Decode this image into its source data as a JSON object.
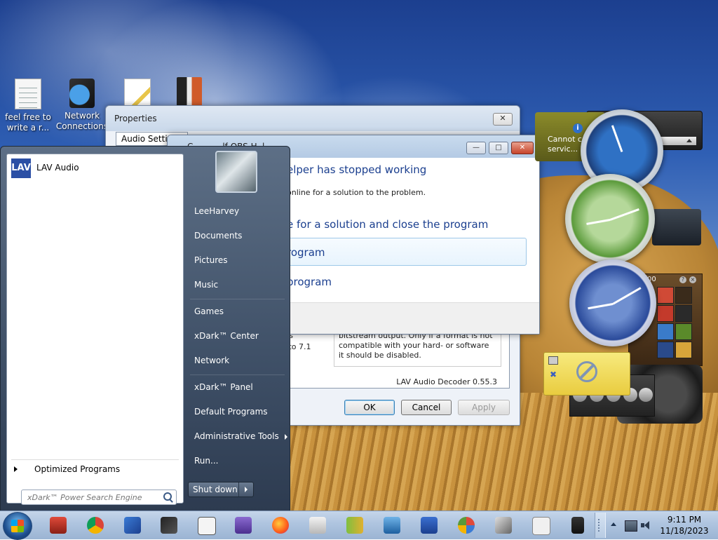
{
  "desktop": {
    "icons": [
      {
        "label": "feel free to write a r...",
        "icon": "text-document-icon"
      },
      {
        "label": "Network Connections",
        "icon": "network-connections-icon"
      },
      {
        "label": "",
        "icon": "paint-document-icon"
      },
      {
        "label": "",
        "icon": "library-book-icon"
      }
    ]
  },
  "properties_window": {
    "title": "Properties",
    "close_label": "✕",
    "tab": "Audio Settings",
    "fragment_left_1": "uts",
    "fragment_left_2": "1 to 7.1",
    "fragment_right": "bitstream output. Only if a format is not compatible with your hard- or software it should be disabled.",
    "version": "LAV Audio Decoder 0.55.3",
    "ok": "OK",
    "cancel": "Cancel",
    "apply": "Apply"
  },
  "error_dialog": {
    "title_fragment": "C...........lf OBS H..l...",
    "minimize": "—",
    "maximize": "□",
    "close": "✕",
    "heading": "elper has stopped working",
    "subtext": "online for a solution to the problem.",
    "option1": "e for a solution and close the program",
    "option2": "rogram",
    "option3": "program"
  },
  "start_menu": {
    "pinned": [
      {
        "label": "LAV Audio",
        "icon": "lav-audio-icon"
      }
    ],
    "all_programs": "Optimized Programs",
    "search_placeholder": "xDark™ Power Search Engine",
    "right_items": [
      "LeeHarvey",
      "Documents",
      "Pictures",
      "Music",
      "Games",
      "xDark™ Center",
      "Network",
      "xDark™ Panel",
      "Default Programs",
      "Administrative Tools",
      "Run..."
    ],
    "shutdown": "Shut down"
  },
  "gadgets": {
    "warning_text": "Cannot c... to servic...",
    "info_glyph": "i",
    "puzzle_number": "00",
    "puzzle_help": "?",
    "puzzle_close": "×"
  },
  "taskbar": {
    "apps": [
      "explorer-store-icon",
      "chrome-icon",
      "control-panel-icon",
      "paint-brush-icon",
      "solitaire-icon",
      "media-icon",
      "firefox-icon",
      "scanner-icon",
      "hxd-icon",
      "remote-desktop-icon",
      "system-monitor-icon",
      "palette-icon",
      "photo-viewer-icon",
      "notepad-icon",
      "pos-terminal-icon"
    ],
    "clock_time": "9:11 PM",
    "clock_date": "11/18/2023"
  },
  "colors": {
    "accent": "#1b3f8f",
    "start_menu": "#3e4f66",
    "taskbar": "#aec4df"
  }
}
